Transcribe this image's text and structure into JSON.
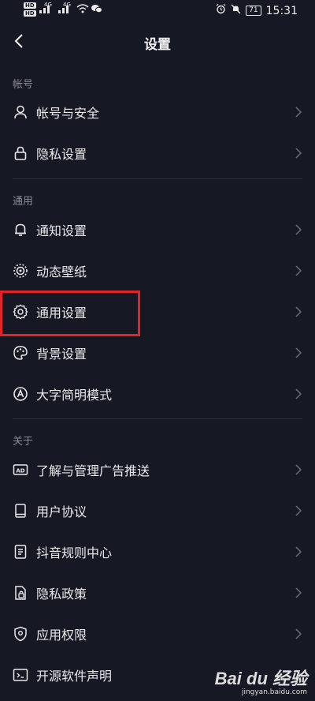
{
  "status_bar": {
    "hd1": "HD",
    "hd2": "HD",
    "sig1": "4G",
    "sig2": "4G",
    "battery": "71",
    "time": "15:31"
  },
  "nav": {
    "title": "设置"
  },
  "sections": [
    {
      "header": "帐号",
      "items": [
        {
          "label": "帐号与安全",
          "icon": "person-icon"
        },
        {
          "label": "隐私设置",
          "icon": "lock-icon"
        }
      ]
    },
    {
      "header": "通用",
      "items": [
        {
          "label": "通知设置",
          "icon": "bell-icon"
        },
        {
          "label": "动态壁纸",
          "icon": "dynamic-wallpaper-icon"
        },
        {
          "label": "通用设置",
          "icon": "gear-icon"
        },
        {
          "label": "背景设置",
          "icon": "palette-icon"
        },
        {
          "label": "大字简明模式",
          "icon": "font-size-icon"
        }
      ]
    },
    {
      "header": "关于",
      "items": [
        {
          "label": "了解与管理广告推送",
          "icon": "ad-icon"
        },
        {
          "label": "用户协议",
          "icon": "book-icon"
        },
        {
          "label": "抖音规则中心",
          "icon": "document-icon"
        },
        {
          "label": "隐私政策",
          "icon": "privacy-doc-icon"
        },
        {
          "label": "应用权限",
          "icon": "shield-icon"
        },
        {
          "label": "开源软件声明",
          "icon": "code-icon"
        }
      ]
    }
  ],
  "watermark": {
    "brand": "Bai du 经验",
    "url": "jingyan.baidu.com"
  },
  "colors": {
    "background": "#161824",
    "text": "#e9e9ee",
    "muted": "#8a8b96",
    "highlight": "#e3232a"
  }
}
